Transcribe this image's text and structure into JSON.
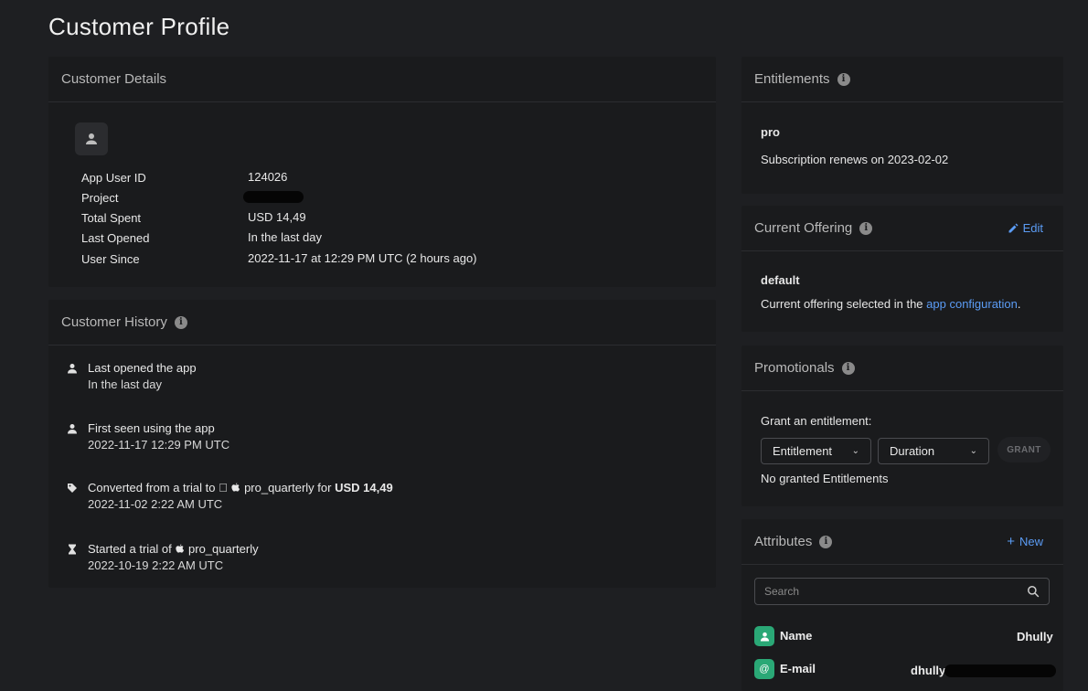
{
  "page": {
    "title": "Customer Profile"
  },
  "details": {
    "header": "Customer Details",
    "rows": [
      {
        "label": "App User ID",
        "value": "124026"
      },
      {
        "label": "Project",
        "value": ""
      },
      {
        "label": "Total Spent",
        "value": "USD 14,49"
      },
      {
        "label": "Last Opened",
        "value": "In the last day"
      },
      {
        "label": "User Since",
        "value": "2022-11-17 at 12:29 PM UTC (2 hours ago)"
      }
    ]
  },
  "history": {
    "header": "Customer History",
    "items": [
      {
        "icon": "person-icon",
        "title": "Last opened the app",
        "sub": "In the last day"
      },
      {
        "icon": "person-icon",
        "title": "First seen using the app",
        "sub": "2022-11-17 12:29 PM UTC"
      },
      {
        "icon": "tag-icon",
        "title_prefix": "Converted from a trial to ",
        "product": "pro_quarterly",
        "title_mid": " for ",
        "amount": "USD 14,49",
        "sub": "2022-11-02 2:22 AM UTC"
      },
      {
        "icon": "hourglass-icon",
        "title_prefix": "Started a trial of ",
        "product": "pro_quarterly",
        "sub": "2022-10-19 2:22 AM UTC"
      }
    ]
  },
  "entitlements": {
    "header": "Entitlements",
    "name": "pro",
    "renewal": "Subscription renews on 2023-02-02"
  },
  "offering": {
    "header": "Current Offering",
    "edit_label": "Edit",
    "name": "default",
    "desc_prefix": "Current offering selected in the ",
    "link": "app configuration",
    "desc_suffix": "."
  },
  "promotionals": {
    "header": "Promotionals",
    "grant_label": "Grant an entitlement:",
    "entitlement_select": "Entitlement",
    "duration_select": "Duration",
    "grant_button": "GRANT",
    "empty": "No granted Entitlements"
  },
  "attributes": {
    "header": "Attributes",
    "new_label": "New",
    "search_placeholder": "Search",
    "items": [
      {
        "icon": "person-icon",
        "key": "Name",
        "value": "Dhully"
      },
      {
        "icon": "at-icon",
        "key": "E-mail",
        "value": "dhully"
      }
    ]
  },
  "colors": {
    "background": "#1e1f22",
    "card": "#1a1b1d",
    "accent": "#5b9cf5",
    "badge": "#2aa876"
  }
}
